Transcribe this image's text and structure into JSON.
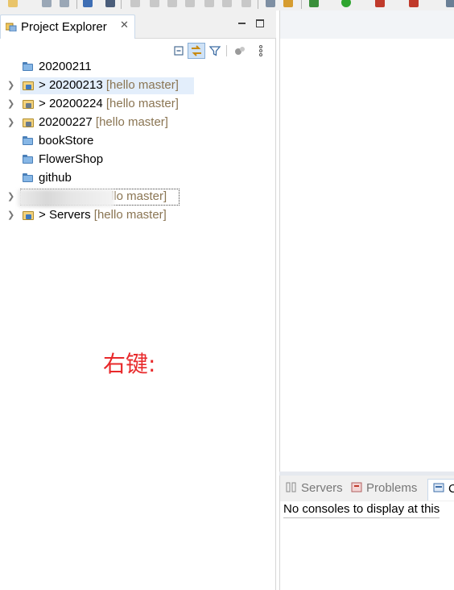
{
  "window": {
    "project_explorer": {
      "tab_title": "Project Explorer",
      "close_glyph": "✕",
      "toolbar_icons": [
        "collapse-all-icon",
        "link-with-editor-icon",
        "filter-icon",
        "git-synchronize-icon",
        "view-menu-icon"
      ],
      "tree": [
        {
          "label": "20200211",
          "branch": "",
          "prefix": "",
          "expandable": false,
          "icon": "folder-icon"
        },
        {
          "label": "20200213",
          "branch": "[hello master]",
          "prefix": "> ",
          "expandable": true,
          "icon": "git-project-icon",
          "selected": true
        },
        {
          "label": "20200224",
          "branch": "[hello master]",
          "prefix": "> ",
          "expandable": true,
          "icon": "git-project-icon"
        },
        {
          "label": "20200227",
          "branch": "[hello master]",
          "prefix": "",
          "expandable": true,
          "icon": "git-project-icon"
        },
        {
          "label": "bookStore",
          "branch": "",
          "prefix": "",
          "expandable": false,
          "icon": "folder-icon"
        },
        {
          "label": "FlowerShop",
          "branch": "",
          "prefix": "",
          "expandable": false,
          "icon": "folder-icon"
        },
        {
          "label": "github",
          "branch": "",
          "prefix": "",
          "expandable": false,
          "icon": "folder-icon"
        },
        {
          "label": "",
          "branch": "llo master]",
          "prefix": "",
          "expandable": true,
          "icon": "git-project-icon",
          "focused": true
        },
        {
          "label": "Servers",
          "branch": "[hello master]",
          "prefix": "> ",
          "expandable": true,
          "icon": "git-project-icon"
        }
      ]
    },
    "annotation": "右键:",
    "bottom_panel": {
      "tabs": [
        {
          "label": "Servers",
          "icon": "servers-icon"
        },
        {
          "label": "Problems",
          "icon": "problems-icon"
        },
        {
          "label": "C",
          "icon": "console-icon",
          "active": true
        }
      ],
      "console_message": "No consoles to display at this"
    }
  }
}
